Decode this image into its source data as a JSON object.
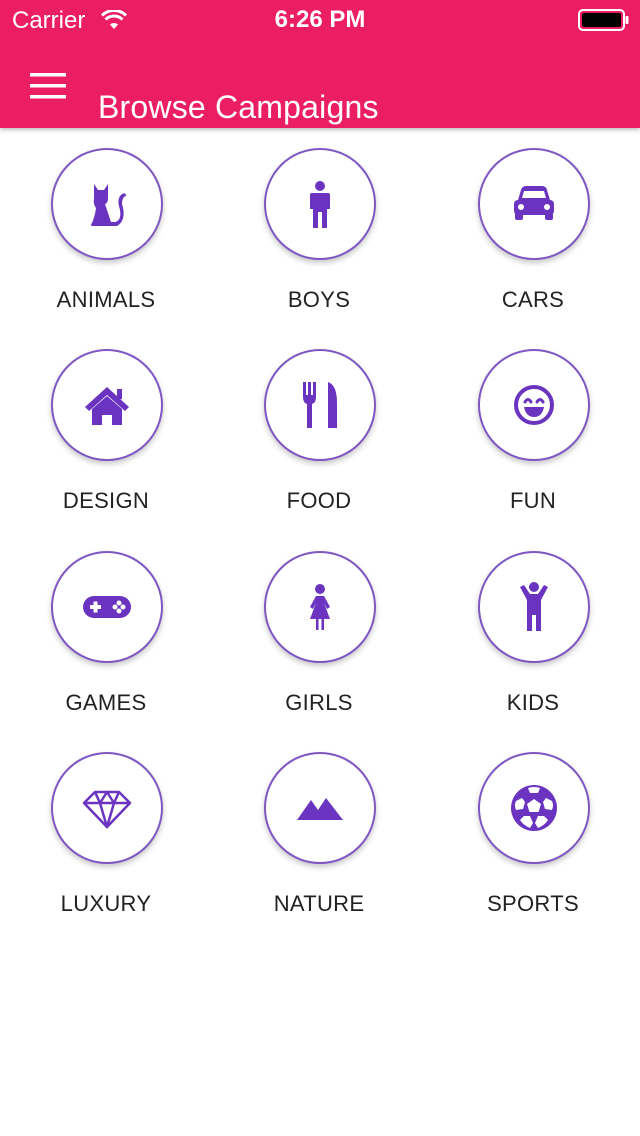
{
  "status_bar": {
    "carrier": "Carrier",
    "time": "6:26 PM"
  },
  "app_bar": {
    "title": "Browse Campaigns",
    "background_color": "#EC1E63",
    "menu_icon": "hamburger-menu-icon"
  },
  "accent_color": "#6A34C1",
  "categories": [
    {
      "label": "ANIMALS",
      "icon": "cat-icon"
    },
    {
      "label": "BOYS",
      "icon": "boy-icon"
    },
    {
      "label": "CARS",
      "icon": "car-icon"
    },
    {
      "label": "DESIGN",
      "icon": "home-icon"
    },
    {
      "label": "FOOD",
      "icon": "fork-knife-icon"
    },
    {
      "label": "FUN",
      "icon": "smiley-icon"
    },
    {
      "label": "GAMES",
      "icon": "gamepad-icon"
    },
    {
      "label": "GIRLS",
      "icon": "girl-icon"
    },
    {
      "label": "KIDS",
      "icon": "child-icon"
    },
    {
      "label": "LUXURY",
      "icon": "diamond-icon"
    },
    {
      "label": "NATURE",
      "icon": "mountains-icon"
    },
    {
      "label": "SPORTS",
      "icon": "soccer-ball-icon"
    }
  ]
}
